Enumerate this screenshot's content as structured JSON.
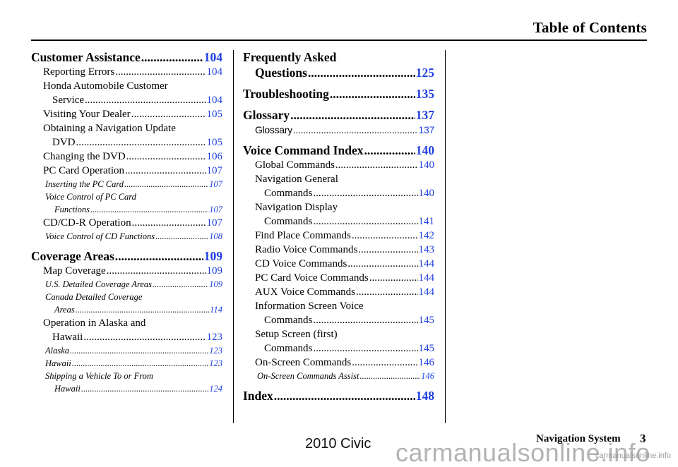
{
  "header": {
    "title": "Table of Contents"
  },
  "colors": {
    "page_number": "#1f3fe0",
    "text": "#000000"
  },
  "column1": {
    "customer_assistance": {
      "label": "Customer Assistance",
      "page": "104"
    },
    "reporting_errors": {
      "label": "Reporting Errors",
      "page": "104"
    },
    "honda_service_1": "Honda Automobile Customer",
    "honda_service_2": {
      "label": "Service",
      "page": "104"
    },
    "visiting_dealer": {
      "label": "Visiting Your Dealer",
      "page": "105"
    },
    "obtaining_update_1": "Obtaining a Navigation Update",
    "obtaining_update_2": {
      "label": "DVD",
      "page": "105"
    },
    "changing_dvd": {
      "label": "Changing the DVD",
      "page": "106"
    },
    "pc_card_operation": {
      "label": "PC Card Operation",
      "page": "107"
    },
    "inserting_pc_card": {
      "label": "Inserting the PC Card",
      "page": "107"
    },
    "voice_pc_card_1": "Voice Control of PC Card",
    "voice_pc_card_2": {
      "label": "Functions",
      "page": "107"
    },
    "cd_operation": {
      "label": "CD/CD-R Operation",
      "page": "107"
    },
    "voice_cd": {
      "label": "Voice Control of CD Functions",
      "page": "108"
    },
    "coverage_areas": {
      "label": "Coverage Areas",
      "page": "109"
    },
    "map_coverage": {
      "label": "Map Coverage",
      "page": "109"
    },
    "us_detailed": {
      "label": "U.S. Detailed Coverage Areas",
      "page": "109"
    },
    "canada_detailed_1": "Canada Detailed Coverage",
    "canada_detailed_2": {
      "label": "Areas",
      "page": "114"
    },
    "alaska_hawaii_1": "Operation in Alaska and",
    "alaska_hawaii_2": {
      "label": "Hawaii",
      "page": "123"
    },
    "alaska": {
      "label": "Alaska",
      "page": "123"
    },
    "hawaii": {
      "label": "Hawaii",
      "page": "123"
    },
    "shipping_1": "Shipping a Vehicle To or From",
    "shipping_2": {
      "label": "Hawaii",
      "page": "124"
    }
  },
  "column2": {
    "faq_1": "Frequently Asked",
    "faq_2": {
      "label": "Questions",
      "page": "125"
    },
    "troubleshooting": {
      "label": "Troubleshooting",
      "page": "135"
    },
    "glossary": {
      "label": "Glossary",
      "page": "137"
    },
    "glossary_sub": {
      "label": "Glossary",
      "page": "137"
    },
    "voice_index": {
      "label": "Voice Command Index",
      "page": "140"
    },
    "global_commands": {
      "label": "Global Commands",
      "page": "140"
    },
    "nav_general_1": "Navigation General",
    "nav_general_2": {
      "label": "Commands",
      "page": "140"
    },
    "nav_display_1": "Navigation Display",
    "nav_display_2": {
      "label": "Commands",
      "page": "141"
    },
    "find_place": {
      "label": "Find Place Commands",
      "page": "142"
    },
    "radio_voice": {
      "label": "Radio Voice Commands",
      "page": "143"
    },
    "cd_voice": {
      "label": "CD Voice Commands",
      "page": "144"
    },
    "pc_card_voice": {
      "label": "PC Card Voice Commands",
      "page": "144"
    },
    "aux_voice": {
      "label": "AUX Voice Commands",
      "page": "144"
    },
    "info_screen_1": "Information Screen Voice",
    "info_screen_2": {
      "label": "Commands",
      "page": "145"
    },
    "setup_screen_1": "Setup Screen (first)",
    "setup_screen_2": {
      "label": "Commands",
      "page": "145"
    },
    "on_screen": {
      "label": "On-Screen Commands",
      "page": "146"
    },
    "on_screen_assist": {
      "label": "On-Screen Commands Assist",
      "page": "146"
    },
    "index": {
      "label": "Index",
      "page": "148"
    }
  },
  "footer": {
    "section_title": "Navigation System",
    "page_number": "3",
    "model_label": "2010 Civic",
    "watermark": "carmanualsonline.info",
    "watermark_small": "carmanualsonline.info"
  }
}
